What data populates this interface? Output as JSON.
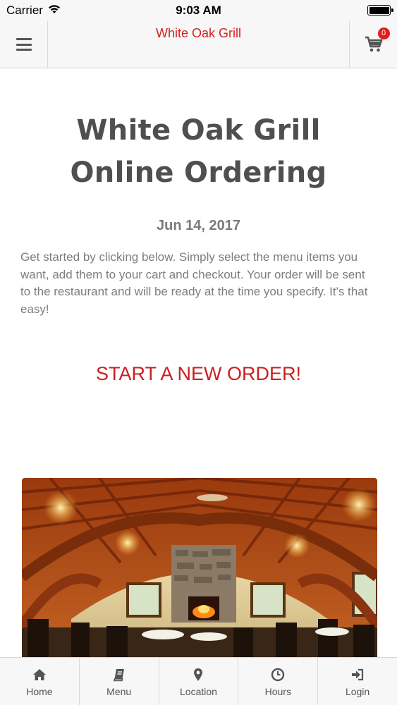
{
  "status_bar": {
    "carrier": "Carrier",
    "time": "9:03 AM"
  },
  "nav": {
    "title": "White Oak Grill",
    "cart_count": "0",
    "menu_icon": "hamburger-icon",
    "cart_icon": "shopping-cart-icon"
  },
  "hero": {
    "title_line1": "White Oak Grill",
    "title_line2": "Online Ordering",
    "date": "Jun 14, 2017",
    "intro": "Get started by clicking below. Simply select the menu items you want, add them to your cart and checkout. Your order will be sent to the restaurant and will be ready at the time you specify. It's that easy!",
    "cta": "START A NEW ORDER!"
  },
  "tabs": [
    {
      "label": "Home",
      "icon": "home-icon"
    },
    {
      "label": "Menu",
      "icon": "book-icon"
    },
    {
      "label": "Location",
      "icon": "map-pin-icon"
    },
    {
      "label": "Hours",
      "icon": "clock-icon"
    },
    {
      "label": "Login",
      "icon": "sign-in-icon"
    }
  ],
  "colors": {
    "accent": "#d42020",
    "badge": "#e51c1c",
    "bar_bg": "#f7f7f7"
  }
}
